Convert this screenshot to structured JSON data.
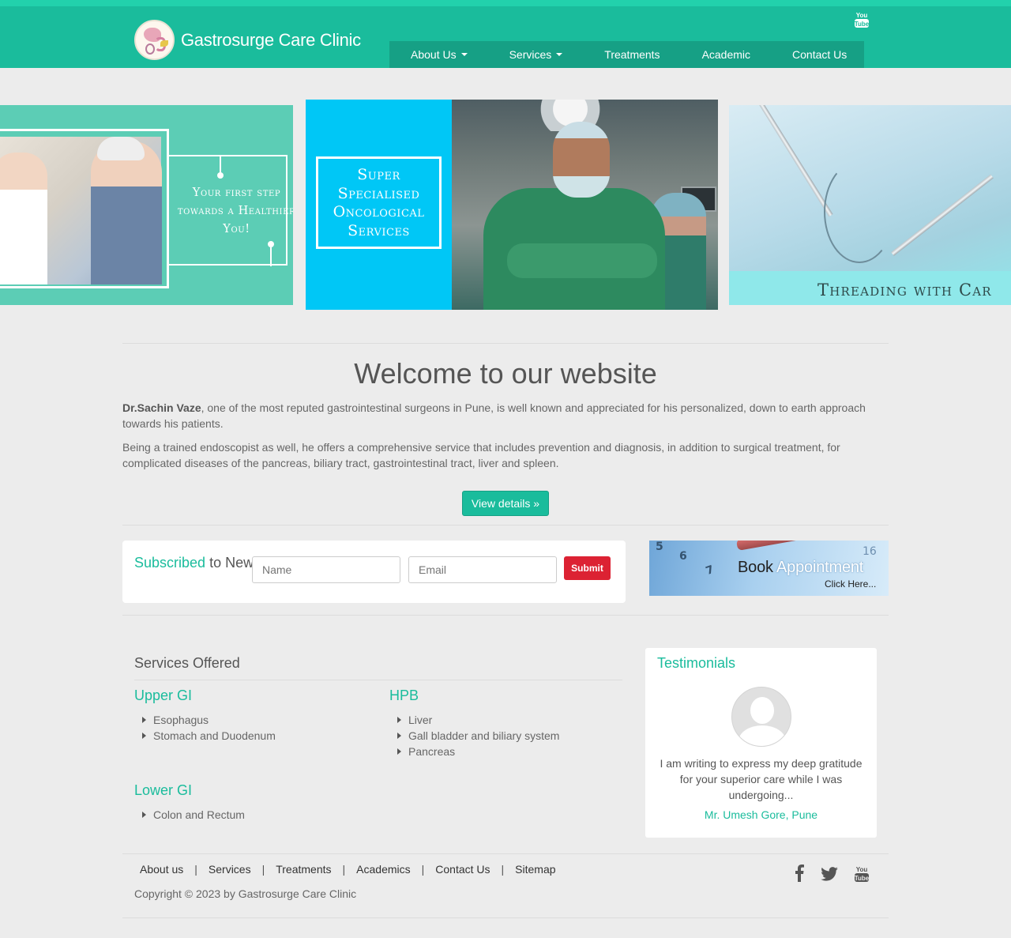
{
  "header": {
    "brand": "Gastrosurge Care Clinic",
    "youtube_icon_top": "youtube-icon",
    "nav": [
      {
        "label": "About Us",
        "dropdown": true
      },
      {
        "label": "Services",
        "dropdown": true
      },
      {
        "label": "Treatments",
        "dropdown": false
      },
      {
        "label": "Academic",
        "dropdown": false
      },
      {
        "label": "Contact Us",
        "dropdown": false
      }
    ]
  },
  "carousel": {
    "slide1_text": "Your first step towards a Healthier You!",
    "slide2_text": "Super Specialised Oncological Services",
    "slide3_text": "Threading with Car"
  },
  "welcome": {
    "title": "Welcome to our website",
    "doctor": "Dr.Sachin Vaze",
    "p1_rest": ",  one of the most reputed gastrointestinal surgeons in Pune, is well known and appreciated for his personalized, down to earth approach towards his patients.",
    "p2": "Being a trained endoscopist as well, he offers a comprehensive service that includes prevention and diagnosis, in addition to surgical treatment, for complicated diseases of the pancreas, biliary tract, gastrointestinal tract, liver and spleen.",
    "button": "View details »"
  },
  "newsletter": {
    "title_accent": "Subscribed",
    "title_rest": " to Newsletter",
    "name_placeholder": "Name",
    "email_placeholder": "Email",
    "submit": "Submit"
  },
  "appointment": {
    "title_dark": "Book ",
    "title_light": "Appointment",
    "subtitle": "Click Here..."
  },
  "services": {
    "title": "Services Offered",
    "categories": [
      {
        "name": "Upper GI",
        "items": [
          "Esophagus",
          "Stomach and Duodenum"
        ]
      },
      {
        "name": "HPB",
        "items": [
          "Liver",
          "Gall bladder and biliary system",
          "Pancreas"
        ]
      },
      {
        "name": "Lower GI",
        "items": [
          "Colon and Rectum"
        ]
      }
    ]
  },
  "testimonials": {
    "title": "Testimonials",
    "quote": "I am writing to express my deep gratitude for your superior care while I was undergoing...",
    "author": "Mr. Umesh Gore, Pune"
  },
  "footer": {
    "links": [
      "About us",
      "Services",
      "Treatments",
      "Academics",
      "Contact Us",
      "Sitemap"
    ],
    "separator": "|",
    "copyright": "Copyright © 2023 by Gastrosurge Care Clinic",
    "social": [
      "facebook-icon",
      "twitter-icon",
      "youtube-icon"
    ]
  },
  "colors": {
    "primary": "#1abc9c",
    "primary_dark": "#16a085",
    "topbar": "#22d1ac",
    "submit": "#dc2233",
    "background": "#ececec"
  }
}
